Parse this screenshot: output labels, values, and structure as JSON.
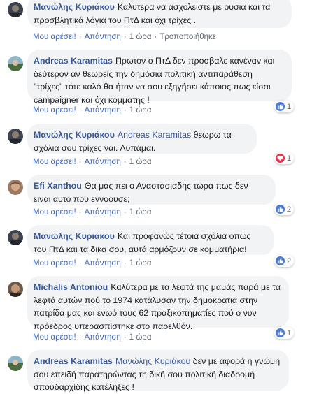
{
  "colors": {
    "author": "#385898",
    "link": "#4267b2",
    "bubble": "#f2f3f5",
    "like": "#4a7bd6",
    "love": "#e0384e"
  },
  "action_labels": {
    "like": "Μου αρέσει!",
    "reply": "Απάντηση",
    "edited": "Τροποποιήθηκε"
  },
  "comments": [
    {
      "author": "Μανώλης Κυριάκου",
      "text": "Καλυτερα να ασχολειστε με ουσια και τα προσβλητικά λόγια του ΠτΔ και όχι τρίχες .",
      "time": "1 ώρα"
    },
    {
      "author": "Andreas Karamitas",
      "text": "Πρωτον ο ΠτΔ δεν προσβαλε κανέναν και δεύτερον αν θεωρείς την δημόσια πολιτική αντιπαράθεση \"τρίχες\" τότε καλό θα ήταν να σου εξηγήσει κάποιος πως είσαι campaigner και όχι κομματης !",
      "time": "1 ώρα",
      "reaction": {
        "icon": "like-icon",
        "count": "1"
      }
    },
    {
      "author": "Μανώλης Κυριάκου",
      "mention": "Andreas Karamitas",
      "text": "θεωρω τα σχόλια σου τρίχες ναι. Λυπάμαι.",
      "time": "1 ώρα",
      "reaction": {
        "icon": "love-icon",
        "count": "1"
      }
    },
    {
      "author": "Efi Xanthou",
      "text": "Θα μας πει ο Αναστασιαδης τωρα πως δεν ειναι αυτο που εννοουσε;",
      "time": "1 ώρα",
      "reaction": {
        "icon": "like-icon",
        "count": "2"
      }
    },
    {
      "author": "Μανώλης Κυριάκου",
      "text": "Και προφανώς τέτοια σχόλια οπως του ΠτΔ και τα δικα σου, αυτά αρμόζουν σε κομματήρια!",
      "time": "1 ώρα",
      "reaction": {
        "icon": "like-icon",
        "count": "2"
      }
    },
    {
      "author": "Michalis Antoniou",
      "text": "Καλύτερα με τα λεφτά της μαμάς παρά με τα λεφτά αυτών πού το 1974 κατάλυσαν την δημοκρατια στην πατρίδα μας και ενωό τους 62 πραξικοπηματίες πού ο νυν πρόεδρος υπερασπίστηκε στο παρελθόν.",
      "time": "1 ώρα",
      "reaction": {
        "icon": "like-icon",
        "count": "1"
      }
    },
    {
      "author": "Andreas Karamitas",
      "mention": "Μανώλης Κυριάκου",
      "text": "δεν με αφορά η γνώμη σου επειδή παρατηρώντας τη δική σου πολιτική διαδρομή σπουδαρχίδης κατέληξες !",
      "time": ""
    }
  ]
}
